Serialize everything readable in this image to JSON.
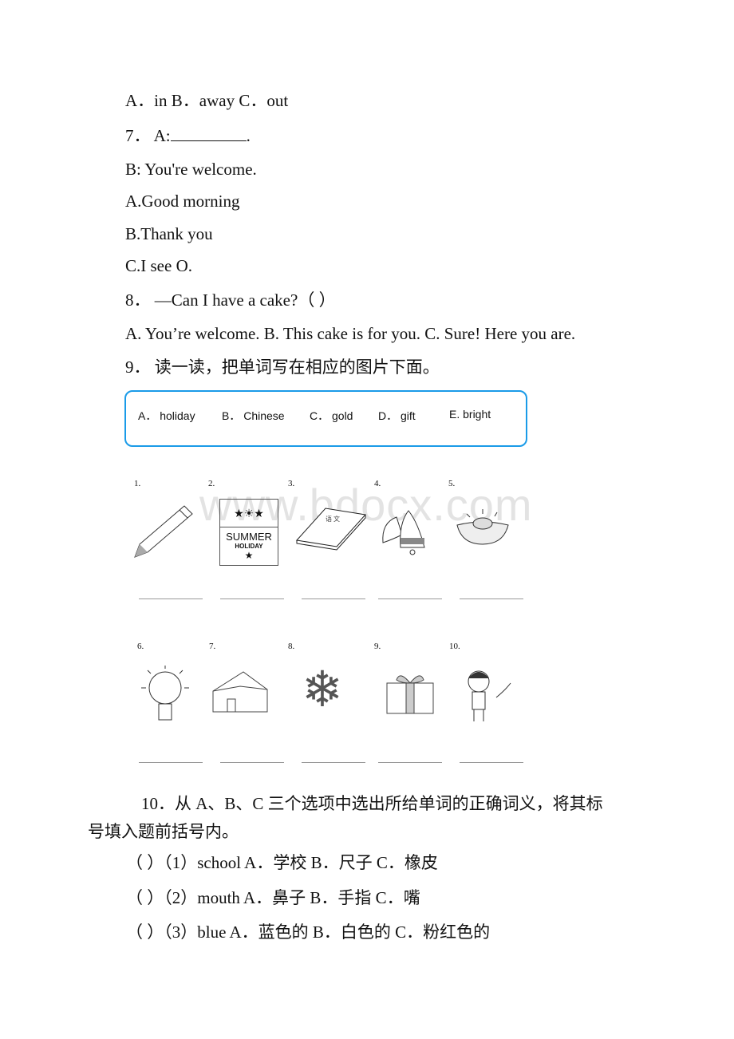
{
  "lines": [
    "A．in B．away C．out",
    "7． A:",
    "B: You're welcome.",
    "A.Good morning",
    "B.Thank you",
    "C.I see O.",
    "8． —Can I have a cake?（ ）",
    "A. You’re welcome. B. This cake is for you. C. Sure! Here you are.",
    "9． 读一读，把单词写在相应的图片下面。"
  ],
  "q7_end": ".",
  "box_options": [
    "A． holiday",
    "B． Chinese",
    "C． gold",
    "D． gift",
    "E. bright"
  ],
  "pictures_row1": {
    "labels": [
      "1.",
      "2.",
      "3.",
      "4.",
      "5."
    ],
    "summer": "SUMMER",
    "holiday": "HOLIDAY",
    "book_text": "语 文"
  },
  "pictures_row2": {
    "labels": [
      "6.",
      "7.",
      "8.",
      "9.",
      "10."
    ]
  },
  "watermark": "www.bdocx.com",
  "q10": {
    "title_line1": "10．从 A、B、C 三个选项中选出所给单词的正确词义，将其标",
    "title_line2": "号填入题前括号内。",
    "items": [
      "（ ）（1）school  A．学校  B．尺子  C．橡皮",
      "（ ）（2）mouth  A．鼻子  B．手指  C．嘴",
      "（ ）（3）blue  A．蓝色的  B．白色的  C．粉红色的"
    ]
  }
}
